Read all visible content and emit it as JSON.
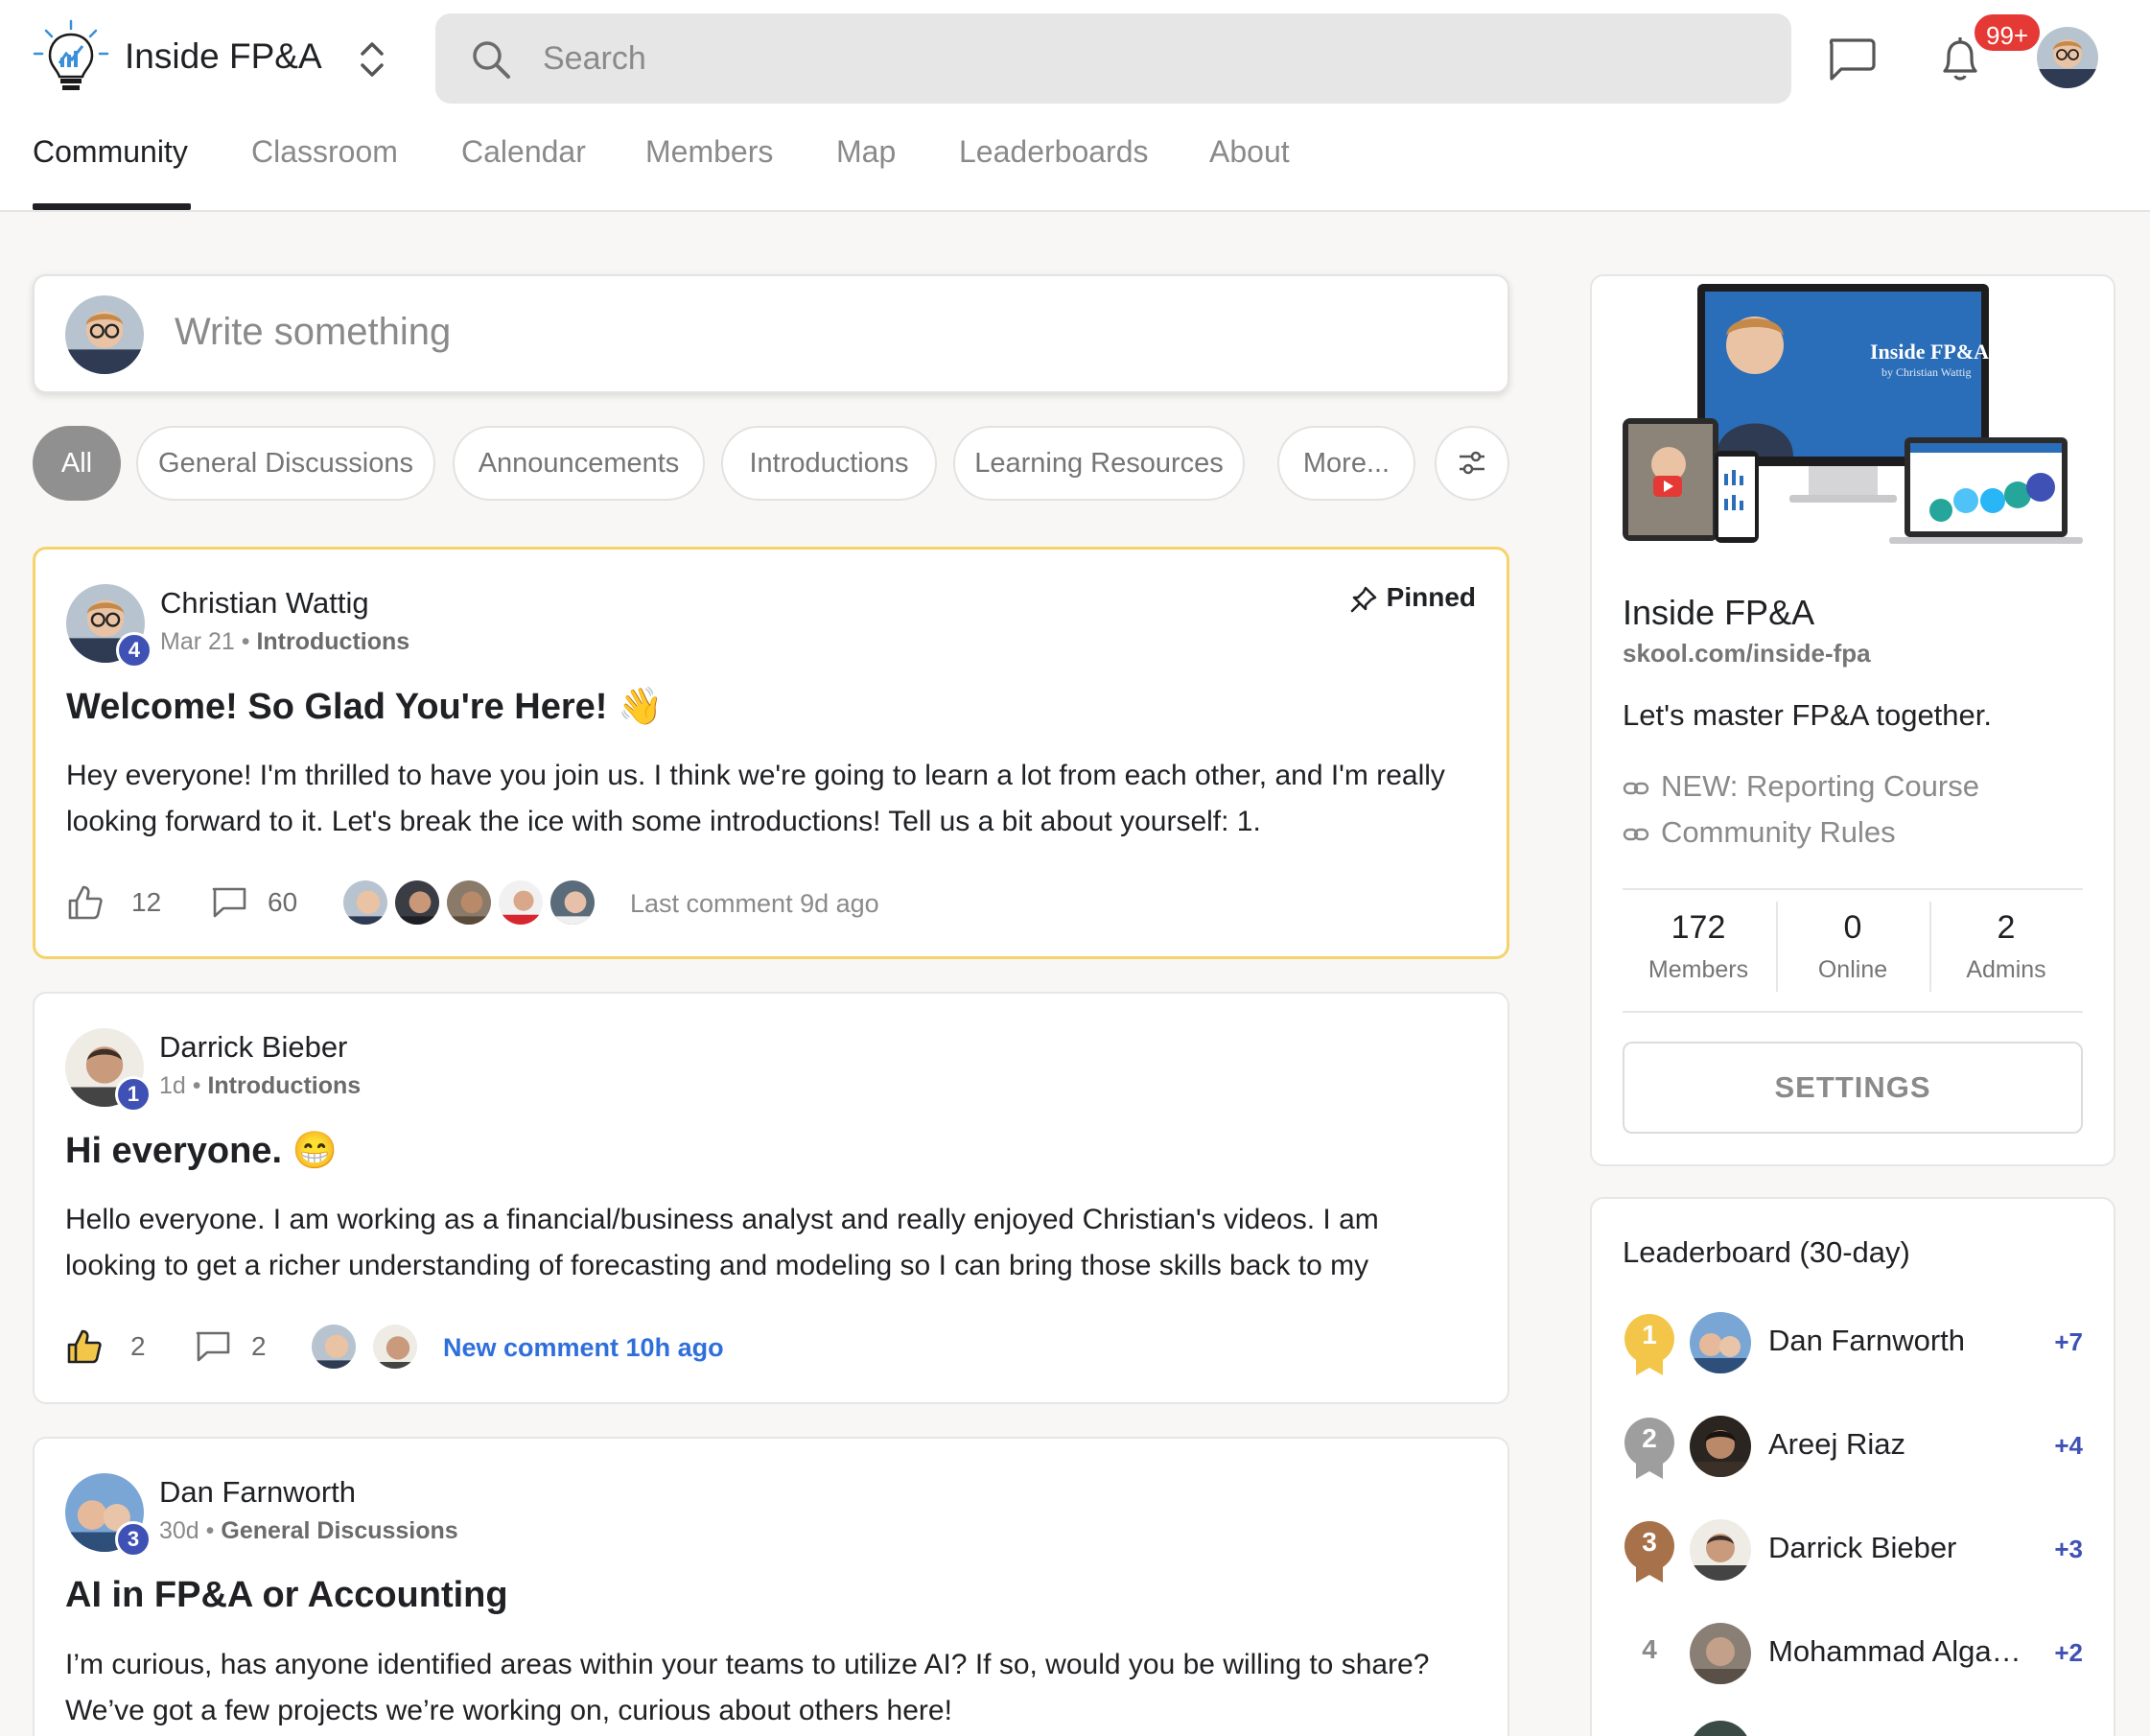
{
  "header": {
    "brand": "Inside FP&A",
    "search_placeholder": "Search",
    "notification_count": "99+"
  },
  "nav": {
    "tabs": [
      {
        "label": "Community",
        "active": true
      },
      {
        "label": "Classroom"
      },
      {
        "label": "Calendar"
      },
      {
        "label": "Members"
      },
      {
        "label": "Map"
      },
      {
        "label": "Leaderboards"
      },
      {
        "label": "About"
      }
    ]
  },
  "composer": {
    "placeholder": "Write something"
  },
  "filters": [
    "All",
    "General Discussions",
    "Announcements",
    "Introductions",
    "Learning Resources",
    "More..."
  ],
  "posts": [
    {
      "author": "Christian Wattig",
      "level": "4",
      "date": "Mar 21",
      "category": "Introductions",
      "pinned_label": "Pinned",
      "title": "Welcome! So Glad You're Here! 👋",
      "body": "Hey everyone! I'm thrilled to have you join us. I think we're going to learn a lot from each other, and I'm really looking forward to it. Let's break the ice with some introductions! Tell us a bit about yourself: 1.",
      "likes": "12",
      "comments": "60",
      "activity": "Last comment 9d ago"
    },
    {
      "author": "Darrick Bieber",
      "level": "1",
      "date": "1d",
      "category": "Introductions",
      "title": "Hi everyone. 😁",
      "body": "Hello everyone. I am working as a financial/business analyst and really enjoyed Christian's videos. I am looking to get a richer understanding of forecasting and modeling so I can bring those skills back to my",
      "likes": "2",
      "comments": "2",
      "activity": "New comment 10h ago"
    },
    {
      "author": "Dan Farnworth",
      "level": "3",
      "date": "30d",
      "category": "General Discussions",
      "title": "AI in FP&A or Accounting",
      "body": "I’m curious, has anyone identified areas within your teams to utilize AI? If so, would you be willing to share? We’ve got a few projects we’re working on, curious about others here!"
    }
  ],
  "group": {
    "cover_title": "Inside FP&A",
    "cover_subtitle": "by Christian Wattig",
    "name": "Inside FP&A",
    "url": "skool.com/inside-fpa",
    "description": "Let's master FP&A together.",
    "links": [
      "NEW: Reporting Course",
      "Community Rules"
    ],
    "stats": [
      {
        "value": "172",
        "label": "Members"
      },
      {
        "value": "0",
        "label": "Online"
      },
      {
        "value": "2",
        "label": "Admins"
      }
    ],
    "settings_label": "SETTINGS"
  },
  "leaderboard": {
    "title": "Leaderboard (30-day)",
    "rows": [
      {
        "rank": "1",
        "name": "Dan Farnworth",
        "points": "+7",
        "medal_color": "#f3c64a"
      },
      {
        "rank": "2",
        "name": "Areej Riaz",
        "points": "+4",
        "medal_color": "#9e9e9e"
      },
      {
        "rank": "3",
        "name": "Darrick Bieber",
        "points": "+3",
        "medal_color": "#a7714a"
      },
      {
        "rank": "4",
        "name": "Mohammad Alga…",
        "points": "+2"
      }
    ]
  },
  "colors": {
    "accent": "#3f51b5",
    "pinned_border": "#f5d36b",
    "notification": "#e53935",
    "link_blue": "#2f6fdb"
  }
}
